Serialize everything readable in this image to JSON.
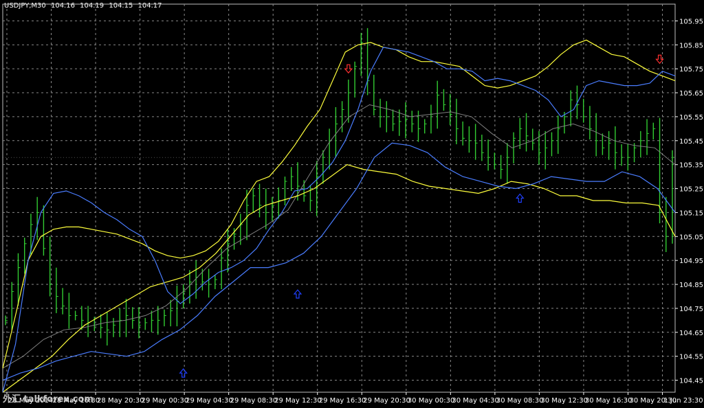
{
  "header": {
    "symbol": "USDJPY,M30",
    "open": "104.16",
    "high": "104.19",
    "low": "104.15",
    "close": "104.17"
  },
  "watermark": "外汇 talkforex.com",
  "colors": {
    "background": "#000000",
    "grid": "#8a8a8a",
    "axis_text": "#ffffff",
    "price_bars": "#32cd32",
    "upper_band_yellow": "#ffff3c",
    "blue_band": "#4a7dff",
    "gray_ma": "#808080",
    "arrow_down": "#ff3030",
    "arrow_up": "#2040ff"
  },
  "chart_data": {
    "type": "bar",
    "title": "USDJPY,M30",
    "y_ticks": [
      "105.95",
      "105.85",
      "105.75",
      "105.65",
      "105.55",
      "105.45",
      "105.35",
      "105.25",
      "105.15",
      "105.05",
      "104.95",
      "104.85",
      "104.75",
      "104.65",
      "104.55",
      "104.45"
    ],
    "ylim": [
      104.4,
      106.02
    ],
    "x_ticks": [
      "28 May 2014",
      "28 May 16:30",
      "28 May 20:30",
      "29 May 00:30",
      "29 May 04:30",
      "29 May 08:30",
      "29 May 12:30",
      "29 May 16:30",
      "29 May 20:30",
      "30 May 00:30",
      "30 May 04:30",
      "30 May 08:30",
      "30 May 12:30",
      "30 May 16:30",
      "30 May 20:30",
      "1 Jun 23:30"
    ],
    "grid": true,
    "series": [
      {
        "kind": "close",
        "values": [
          104.7,
          104.82,
          104.92,
          105.02,
          105.1,
          105.15,
          105.0,
          104.85,
          104.8,
          104.76,
          104.72,
          104.72,
          104.7,
          104.69,
          104.68,
          104.67,
          104.66,
          104.68,
          104.7,
          104.72,
          104.7,
          104.68,
          104.69,
          104.7,
          104.7,
          104.72,
          104.74,
          104.78,
          104.82,
          104.86,
          104.88,
          104.86,
          104.85,
          104.87,
          104.96,
          105.02,
          105.06,
          105.1,
          105.18,
          105.22,
          105.18,
          105.15,
          105.18,
          105.2,
          105.28,
          105.3,
          105.26,
          105.22,
          105.2,
          105.3,
          105.38,
          105.45,
          105.52,
          105.58,
          105.65,
          105.76,
          105.86,
          105.7,
          105.58,
          105.55,
          105.55,
          105.52,
          105.53,
          105.54,
          105.52,
          105.5,
          105.52,
          105.56,
          105.64,
          105.6,
          105.56,
          105.5,
          105.46,
          105.45,
          105.44,
          105.4,
          105.38,
          105.35,
          105.33,
          105.38,
          105.46,
          105.5,
          105.47,
          105.44,
          105.4,
          105.42,
          105.45,
          105.5,
          105.55,
          105.62,
          105.6,
          105.55,
          105.5,
          105.45,
          105.42,
          105.44,
          105.4,
          105.38,
          105.38,
          105.42,
          105.45,
          105.48,
          105.5,
          105.15,
          105.05,
          105.38
        ]
      },
      {
        "kind": "yellow_line",
        "values": [
          104.5,
          104.72,
          104.95,
          105.05,
          105.08,
          105.09,
          105.09,
          105.08,
          105.07,
          105.06,
          105.04,
          105.02,
          104.99,
          104.97,
          104.96,
          104.97,
          104.99,
          105.03,
          105.1,
          105.2,
          105.28,
          105.3,
          105.36,
          105.43,
          105.51,
          105.58,
          105.7,
          105.82,
          105.85,
          105.86,
          105.84,
          105.83,
          105.8,
          105.78,
          105.78,
          105.77,
          105.76,
          105.72,
          105.68,
          105.67,
          105.68,
          105.7,
          105.72,
          105.76,
          105.81,
          105.85,
          105.87,
          105.84,
          105.81,
          105.8,
          105.77,
          105.74,
          105.72,
          105.7
        ]
      },
      {
        "kind": "yellow_line_lower",
        "values": [
          104.4,
          104.45,
          104.5,
          104.55,
          104.62,
          104.68,
          104.72,
          104.76,
          104.8,
          104.84,
          104.86,
          104.88,
          104.92,
          104.98,
          105.06,
          105.14,
          105.18,
          105.2,
          105.22,
          105.25,
          105.3,
          105.35,
          105.33,
          105.32,
          105.31,
          105.28,
          105.26,
          105.25,
          105.24,
          105.23,
          105.25,
          105.28,
          105.27,
          105.25,
          105.22,
          105.22,
          105.2,
          105.2,
          105.19,
          105.19,
          105.18,
          105.05
        ]
      },
      {
        "kind": "blue_line",
        "values": [
          104.4,
          104.6,
          104.95,
          105.15,
          105.23,
          105.24,
          105.22,
          105.19,
          105.15,
          105.12,
          105.08,
          105.05,
          104.95,
          104.82,
          104.77,
          104.81,
          104.86,
          104.9,
          104.92,
          104.95,
          105.0,
          105.08,
          105.15,
          105.24,
          105.25,
          105.3,
          105.36,
          105.45,
          105.58,
          105.74,
          105.84,
          105.83,
          105.82,
          105.8,
          105.78,
          105.75,
          105.75,
          105.74,
          105.7,
          105.71,
          105.7,
          105.68,
          105.66,
          105.62,
          105.55,
          105.58,
          105.68,
          105.7,
          105.69,
          105.68,
          105.68,
          105.69,
          105.74,
          105.72
        ]
      },
      {
        "kind": "blue_line_lower",
        "values": [
          104.45,
          104.48,
          104.5,
          104.53,
          104.55,
          104.57,
          104.56,
          104.55,
          104.57,
          104.62,
          104.66,
          104.72,
          104.8,
          104.86,
          104.92,
          104.92,
          104.94,
          104.98,
          105.05,
          105.15,
          105.25,
          105.38,
          105.44,
          105.43,
          105.4,
          105.34,
          105.3,
          105.28,
          105.26,
          105.25,
          105.27,
          105.3,
          105.29,
          105.28,
          105.28,
          105.32,
          105.3,
          105.25,
          105.15
        ]
      },
      {
        "kind": "gray_ma",
        "values": [
          104.5,
          104.55,
          104.62,
          104.66,
          104.67,
          104.69,
          104.7,
          104.72,
          104.76,
          104.83,
          104.92,
          105.0,
          105.05,
          105.1,
          105.16,
          105.3,
          105.44,
          105.55,
          105.6,
          105.58,
          105.55,
          105.56,
          105.57,
          105.55,
          105.48,
          105.42,
          105.45,
          105.5,
          105.52,
          105.49,
          105.45,
          105.43,
          105.42,
          105.35
        ]
      }
    ],
    "annotations": [
      {
        "type": "arrow_down",
        "x_index": 54,
        "y": 105.75
      },
      {
        "type": "arrow_down",
        "x_index": 103,
        "y": 105.79
      },
      {
        "type": "arrow_up",
        "x_index": 28,
        "y": 104.48
      },
      {
        "type": "arrow_up",
        "x_index": 46,
        "y": 104.81
      },
      {
        "type": "arrow_up",
        "x_index": 81,
        "y": 105.21
      }
    ]
  }
}
